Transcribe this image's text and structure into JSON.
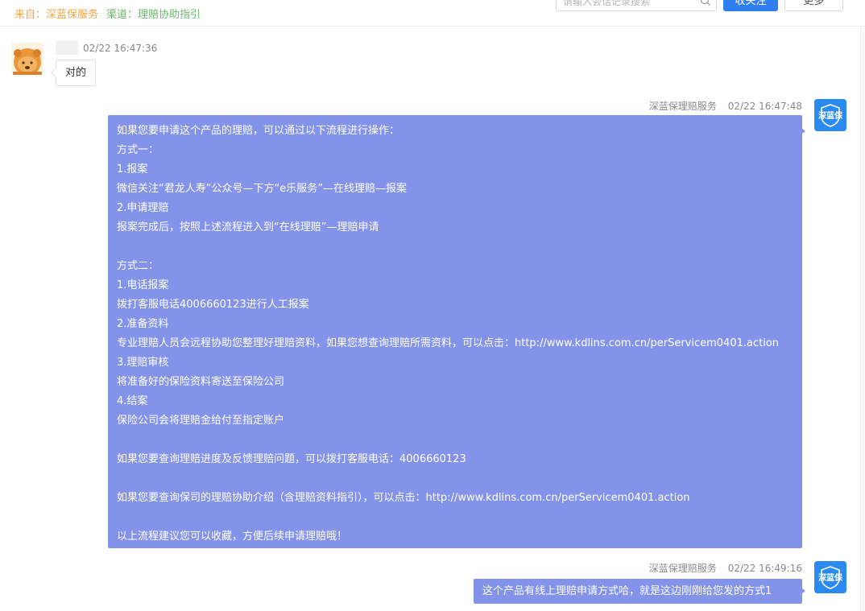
{
  "header": {
    "source_label": "来自：",
    "source_value": "深蓝保服务",
    "channel_label": "渠道：",
    "channel_value": "理赔协助指引",
    "search_placeholder": "请输入会话记录搜索",
    "primary_button": "收关注",
    "more_button": "更多"
  },
  "messages": [
    {
      "side": "left",
      "sender": "",
      "time": "02/22 16:47:36",
      "text": "对的"
    },
    {
      "side": "right",
      "sender": "深蓝保理赔服务",
      "time": "02/22 16:47:48",
      "avatar_text": "深蓝保",
      "lines": [
        "如果您要申请这个产品的理赔，可以通过以下流程进行操作：",
        "方式一：",
        "1.报案",
        "微信关注“君龙人寿”公众号—下方“e乐服务”—在线理赔—报案",
        "2.申请理赔",
        "报案完成后，按照上述流程进入到“在线理赔”—理赔申请",
        "",
        "方式二：",
        "1.电话报案",
        "拨打客服电话4006660123进行人工报案",
        "2.准备资料",
        "专业理赔人员会远程协助您整理好理赔资料，如果您想查询理赔所需资料，可以点击：http://www.kdlins.com.cn/perServicem0401.action",
        "3.理赔审核",
        "将准备好的保险资料寄送至保险公司",
        "4.结案",
        "保险公司会将理赔金给付至指定账户",
        "",
        "如果您要查询理赔进度及反馈理赔问题，可以拨打客服电话：4006660123",
        "",
        "如果您要查询保司的理赔协助介绍（含理赔资料指引），可以点击：http://www.kdlins.com.cn/perServicem0401.action",
        "",
        "以上流程建议您可以收藏，方便后续申请理赔哦！"
      ]
    },
    {
      "side": "right",
      "sender": "深蓝保理赔服务",
      "time": "02/22 16:49:16",
      "avatar_text": "深蓝保",
      "text": "这个产品有线上理赔申请方式哈，就是这边刚刚给您发的方式1"
    }
  ],
  "colors": {
    "bubble_right": "#8493ea",
    "source_orange": "#f0a64a",
    "channel_green": "#6cb86c",
    "primary_blue": "#2f7ff0",
    "avatar_blue": "#2b8af0"
  },
  "icons": {
    "search": "search-icon",
    "left_avatar": "lion-avatar-icon",
    "right_avatar": "shield-logo-icon"
  }
}
